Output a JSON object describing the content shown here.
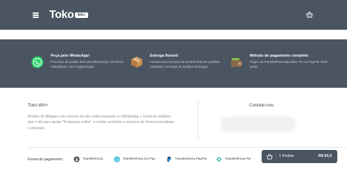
{
  "header": {
    "logo_text": "Toko",
    "logo_badge": "WA+"
  },
  "features": [
    {
      "title": "Peça pelo WhatsApp!",
      "description": "Processo de pedido fácil (via WhatsApp). Checkout instantâneo, sem registro/login.",
      "icon": "whatsapp-icon"
    },
    {
      "title": "Entrega flexível",
      "description": "Fornecemos serviços de recebimento de pedidos (retirada) e entrega de pedidos (entrega).",
      "icon": "package-icon"
    },
    {
      "title": "Método de pagamento completo",
      "description": "Pagar via Transferência Bancária, Pix ou PayPal! Você pode!",
      "icon": "wallet-icon"
    }
  ],
  "footer": {
    "about_title": "Toko WA+",
    "about_text": "Modelo do Blogger com recurso de loja online baseada no WhatsApp + Cesta de pedidos que é útil para ajudar \"Empresas online\" a vender produtos e serviços de forma instantânea e eficiente.",
    "contact_title": "Contate-nos"
  },
  "payment": {
    "label": "Forma de pagamento :",
    "options": [
      {
        "label": "Transferência",
        "icon": "bank-icon"
      },
      {
        "label": "Transferência Go-Pay",
        "icon": "gopay-icon"
      },
      {
        "label": "Transferência PayPal",
        "icon": "paypal-icon"
      },
      {
        "label": "Transferência Pix",
        "icon": "pix-icon"
      }
    ]
  },
  "order_bar": {
    "count_label": "1 Pedido",
    "total_label": "R$ 54,5"
  },
  "colors": {
    "header_bg": "#4a5561",
    "whatsapp_green": "#25d366",
    "accent_teal": "#2ec4b6"
  }
}
